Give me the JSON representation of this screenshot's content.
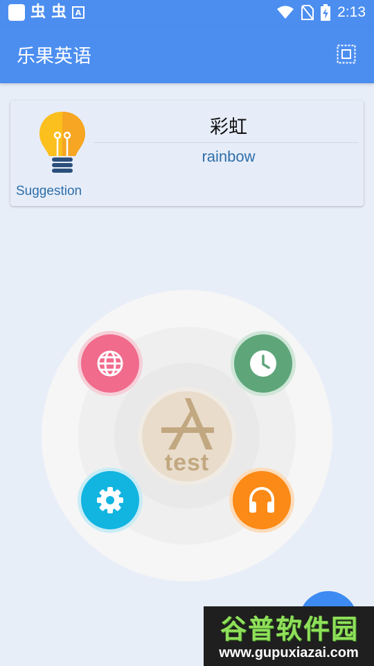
{
  "status_bar": {
    "bug_glyph_1": "虫",
    "bug_glyph_2": "虫",
    "notification_letter": "A",
    "time": "2:13",
    "icons": [
      "app-square-icon",
      "bug-icon",
      "bug-icon",
      "text-a-icon",
      "wifi-icon",
      "no-sim-icon",
      "battery-charging-icon"
    ]
  },
  "toolbar": {
    "title": "乐果英语",
    "action_icon": "scan-frame-icon",
    "color": "#4c8ef0"
  },
  "suggestion_card": {
    "label": "Suggestion",
    "icon": "lightbulb-icon",
    "word_cn": "彩虹",
    "word_en": "rainbow"
  },
  "radial_menu": {
    "center_label": "test",
    "center_icon": "app-store-icon",
    "items": [
      {
        "icon": "globe-icon",
        "color": "#f06b8c"
      },
      {
        "icon": "clock-icon",
        "color": "#5ea67a"
      },
      {
        "icon": "gear-icon",
        "color": "#12b4e0"
      },
      {
        "icon": "headphones-icon",
        "color": "#fb8a16"
      }
    ]
  },
  "watermark": {
    "title": "谷普软件园",
    "url": "www.gupuxiazai.com"
  }
}
